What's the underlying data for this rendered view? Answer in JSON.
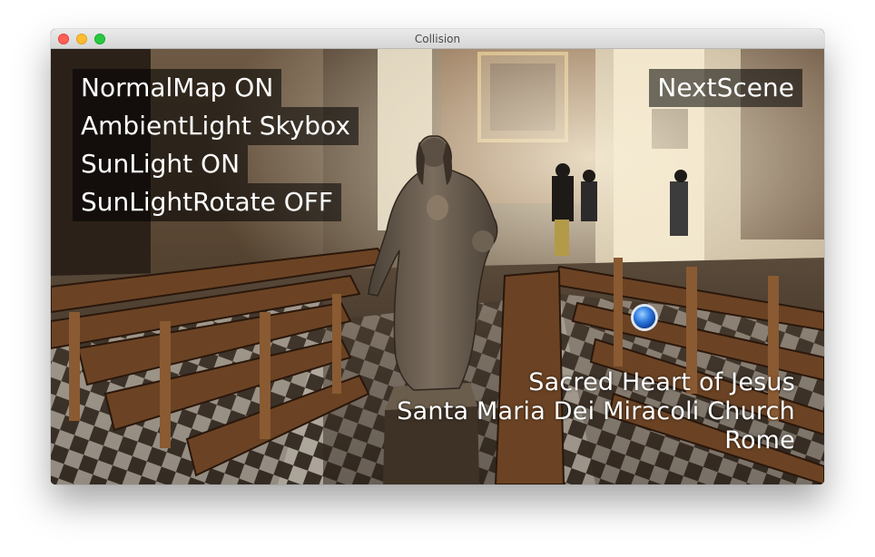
{
  "window": {
    "title": "Collision"
  },
  "menu": {
    "normal_map": "NormalMap ON",
    "ambient_light": "AmbientLight Skybox",
    "sun_light": "SunLight ON",
    "sun_light_rotate": "SunLightRotate OFF"
  },
  "next_scene_label": "NextScene",
  "caption": {
    "line1": "Sacred Heart of Jesus",
    "line2": "Santa Maria Dei Miracoli Church",
    "line3": "Rome"
  },
  "icons": {
    "close": "close-traffic-light",
    "minimize": "minimize-traffic-light",
    "maximize": "maximize-traffic-light",
    "marker": "collision-marker-icon"
  },
  "colors": {
    "close": "#fe5f57",
    "minimize": "#febc2e",
    "maximize": "#28c840",
    "overlay": "rgba(0,0,0,0.55)",
    "text": "#ffffff"
  }
}
